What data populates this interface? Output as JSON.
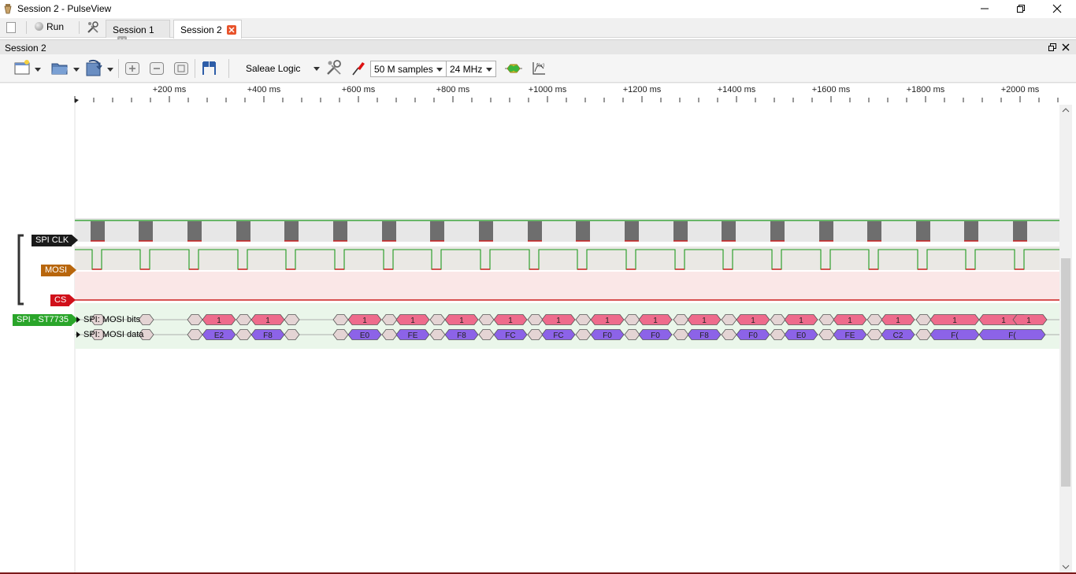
{
  "window": {
    "title": "Session 2 - PulseView"
  },
  "tabbar": {
    "run_label": "Run",
    "tabs": [
      {
        "label": "Session 1"
      },
      {
        "label": "Session 2"
      }
    ],
    "close_colors": {
      "inactive": "#9a9a9a",
      "active": "#e8532b"
    }
  },
  "dock": {
    "title": "Session 2"
  },
  "toolbar": {
    "device": "Saleae Logic",
    "samples": "50 M samples",
    "samplerate": "24 MHz"
  },
  "ruler": {
    "ticks": [
      "+200 ms",
      "+400 ms",
      "+600 ms",
      "+800 ms",
      "+1000 ms",
      "+1200 ms",
      "+1400 ms",
      "+1600 ms",
      "+1800 ms",
      "+2000 ms"
    ]
  },
  "channels": [
    {
      "name": "SPI CLK",
      "color": "#1a1a1a"
    },
    {
      "name": "MOSI",
      "color": "#b8660c"
    },
    {
      "name": "CS",
      "color": "#d0101a"
    }
  ],
  "decoder": {
    "name": "SPI - ST7735",
    "color": "#2aa52a",
    "rows": [
      {
        "label": "SPI: MOSI bits"
      },
      {
        "label": "SPI: MOSI data"
      }
    ],
    "bits_value": "1",
    "data_bytes": [
      "E2",
      "F8",
      "E0",
      "FE",
      "F8",
      "FC",
      "FC",
      "F0",
      "F0",
      "F8",
      "F0",
      "E0",
      "FE",
      "C2",
      "F(",
      "F("
    ],
    "colors": {
      "bits": "#ee6b8c",
      "data": "#8c63e8"
    }
  }
}
